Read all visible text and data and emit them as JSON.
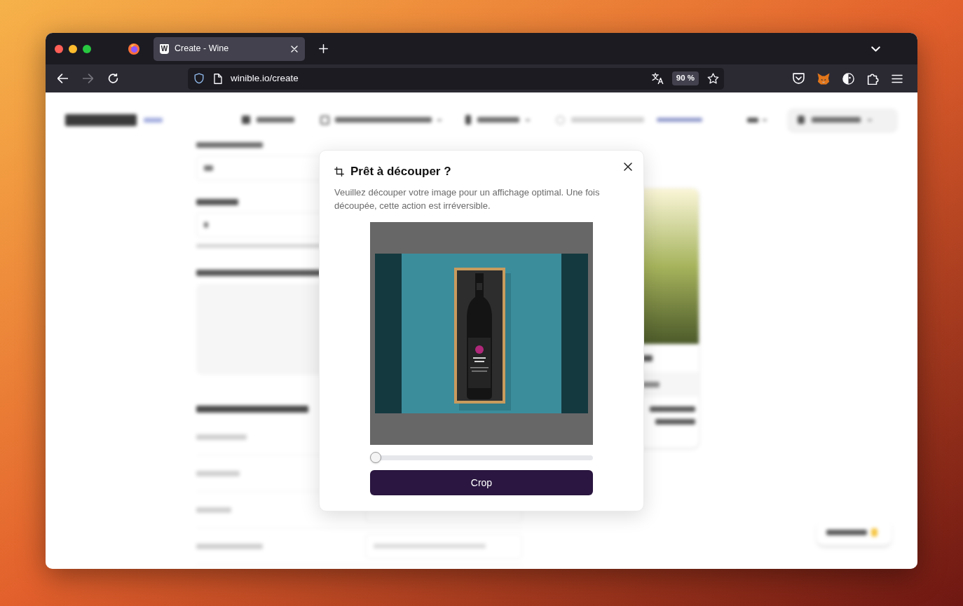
{
  "browser": {
    "tabs": [
      {
        "favicon": "W",
        "title": "Create - Wine",
        "selected": true
      }
    ],
    "nav_buttons": [
      {
        "kind": "back",
        "disabled": false
      },
      {
        "kind": "forward",
        "disabled": true
      },
      {
        "kind": "reload",
        "disabled": false
      }
    ],
    "url": "winible.io/create",
    "zoom_badge": "90 %"
  },
  "crop_dialog": {
    "title": "Prêt à découper ?",
    "description": "Veuillez découper votre image pour un affichage optimal. Une fois découpée, cette action est irréversible.",
    "zoom": {
      "level": 0
    },
    "button": "Crop"
  }
}
